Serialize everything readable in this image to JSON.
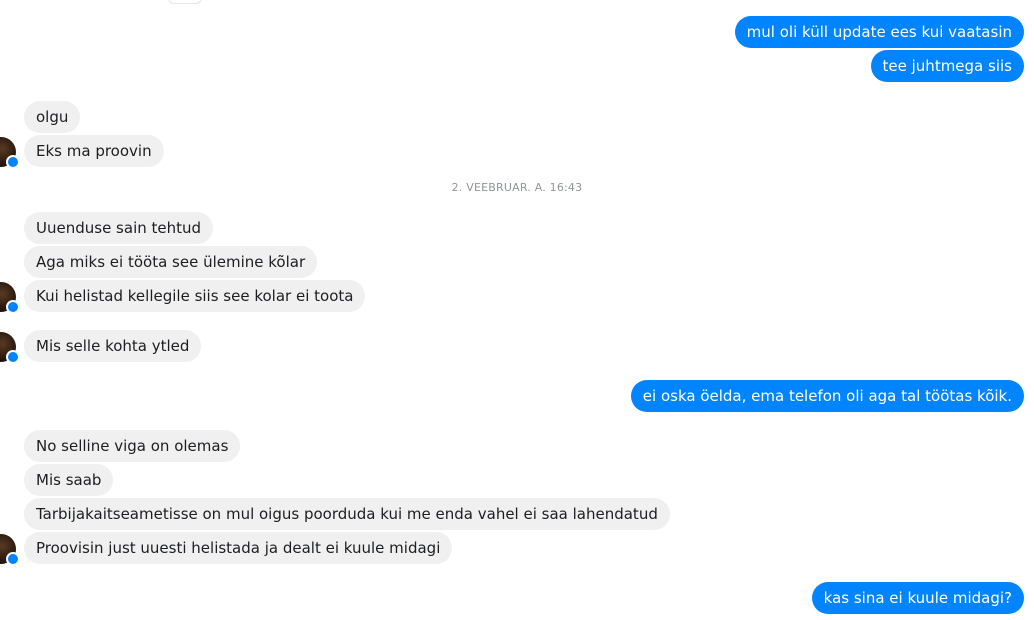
{
  "conversation": {
    "group1_out": [
      "mul oli küll update ees kui vaatasin",
      "tee juhtmega siis"
    ],
    "group2_in": [
      "olgu",
      "Eks ma proovin"
    ],
    "timestamp": "2. VEEBRUAR. A. 16:43",
    "group3_in": [
      "Uuenduse sain tehtud",
      "Aga miks ei tööta see ülemine kõlar",
      "Kui helistad kellegile siis see kolar ei toota"
    ],
    "group4_in": [
      "Mis selle kohta ytled"
    ],
    "group5_out": [
      "ei oska öelda, ema telefon oli aga tal töötas kõik."
    ],
    "group6_in": [
      "No selline viga on olemas",
      "Mis saab",
      "Tarbijakaitseametisse on mul oigus poorduda kui me enda vahel ei saa lahendatud",
      "Proovisin just uuesti helistada ja dealt ei kuule midagi"
    ],
    "group7_out": [
      "kas sina ei kuule midagi?"
    ]
  },
  "colors": {
    "outgoing_bubble": "#0084ff",
    "incoming_bubble": "#f0f0f0",
    "timestamp_text": "#90949c"
  }
}
